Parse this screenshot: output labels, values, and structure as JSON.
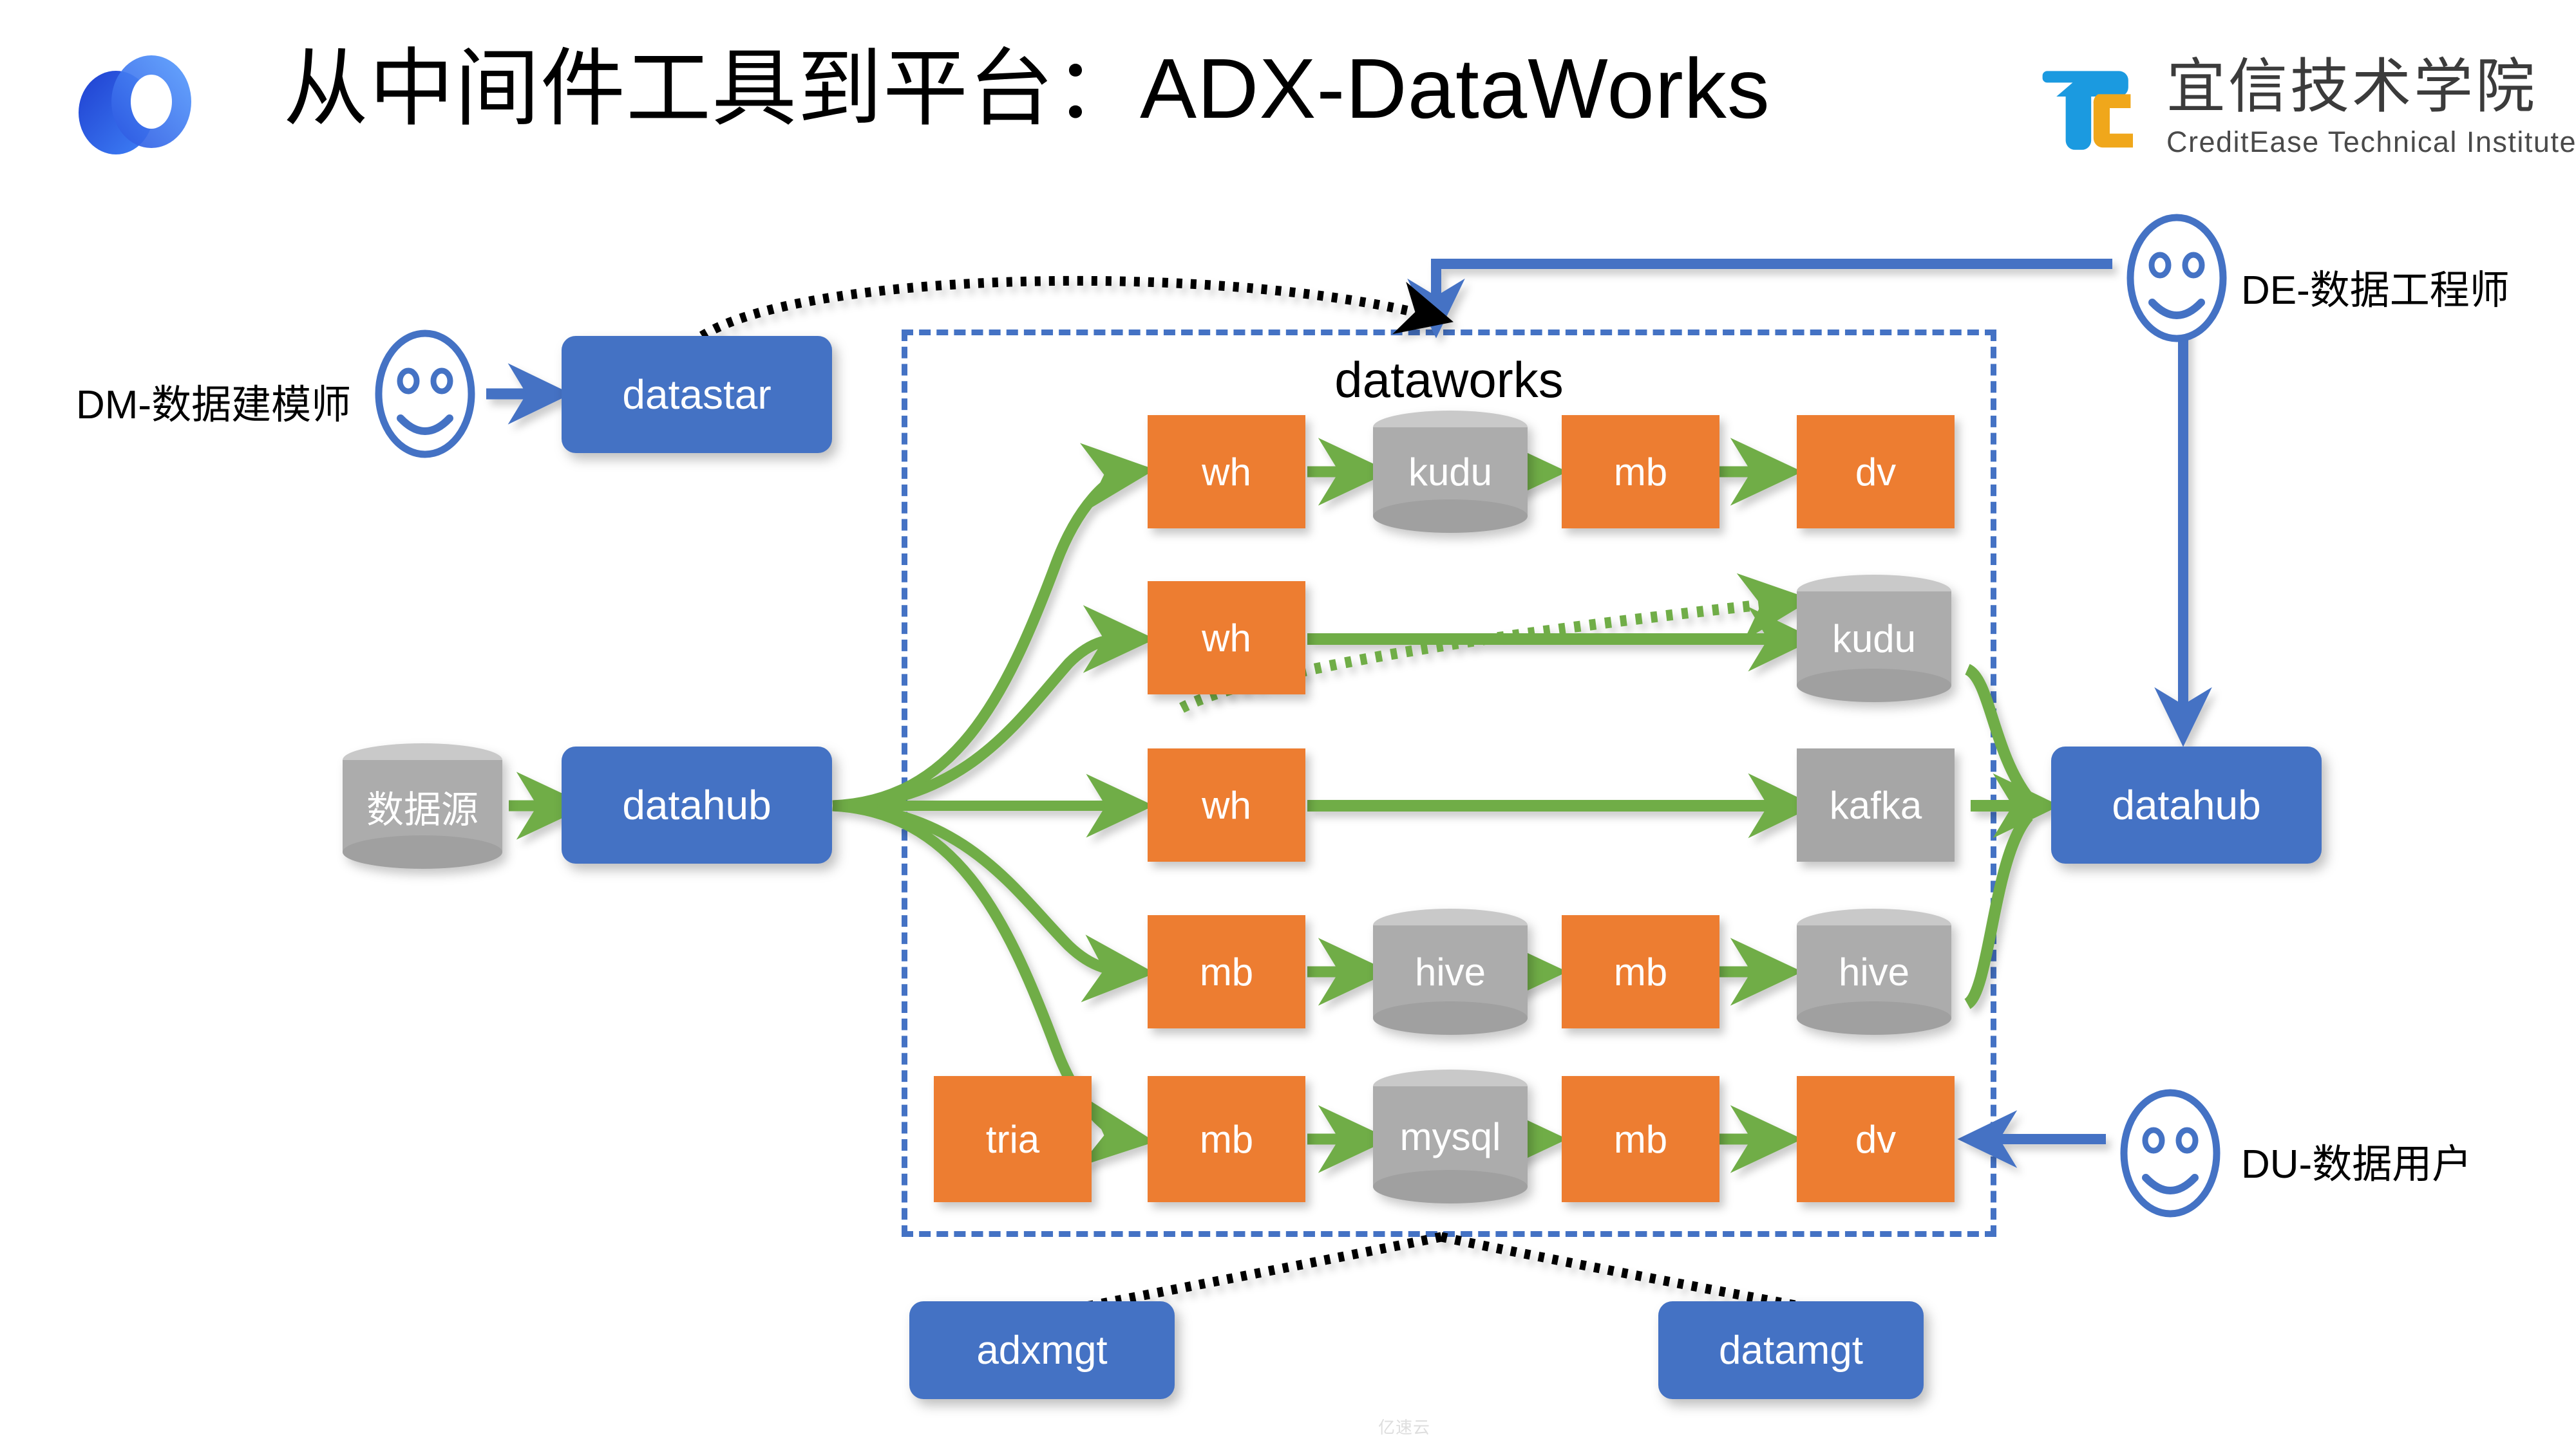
{
  "header": {
    "title": "从中间件工具到平台：ADX-DataWorks",
    "brand_icon": "two-overlapping-rings-logo-icon",
    "logo": {
      "glyph_icon": "tc-monogram-icon",
      "cn_name": "宜信技术学院",
      "en_name": "CreditEase Technical Institute"
    }
  },
  "colors": {
    "accent_blue": "#4472C4",
    "orange": "#ED7D31",
    "gray": "#A6A6A6",
    "green_arrow": "#70AD47",
    "black_dotted": "#000000"
  },
  "actors": [
    {
      "id": "dm",
      "label": "DM-数据建模师",
      "icon": "smiley-face-icon"
    },
    {
      "id": "de",
      "label": "DE-数据工程师",
      "icon": "smiley-face-icon"
    },
    {
      "id": "du",
      "label": "DU-数据用户",
      "icon": "smiley-face-icon"
    }
  ],
  "container": {
    "title": "dataworks",
    "border_style": "dashed"
  },
  "nodes": {
    "datastar": "datastar",
    "source": "数据源",
    "datahub_in": "datahub",
    "datahub_out": "datahub",
    "adxmgt": "adxmgt",
    "datamgt": "datamgt"
  },
  "pipelines": [
    {
      "row": 1,
      "steps": [
        {
          "label": "wh",
          "shape": "rect",
          "color": "orange"
        },
        {
          "label": "kudu",
          "shape": "cylinder",
          "color": "gray"
        },
        {
          "label": "mb",
          "shape": "rect",
          "color": "orange"
        },
        {
          "label": "dv",
          "shape": "rect",
          "color": "orange"
        }
      ]
    },
    {
      "row": 2,
      "steps": [
        {
          "label": "wh",
          "shape": "rect",
          "color": "orange"
        },
        {
          "label": "kudu",
          "shape": "cylinder",
          "color": "gray"
        }
      ]
    },
    {
      "row": 3,
      "steps": [
        {
          "label": "wh",
          "shape": "rect",
          "color": "orange"
        },
        {
          "label": "kafka",
          "shape": "rect",
          "color": "gray"
        }
      ]
    },
    {
      "row": 4,
      "steps": [
        {
          "label": "mb",
          "shape": "rect",
          "color": "orange"
        },
        {
          "label": "hive",
          "shape": "cylinder",
          "color": "gray"
        },
        {
          "label": "mb",
          "shape": "rect",
          "color": "orange"
        },
        {
          "label": "hive",
          "shape": "cylinder",
          "color": "gray"
        }
      ]
    },
    {
      "row": 5,
      "steps": [
        {
          "label": "tria",
          "shape": "rect",
          "color": "orange"
        },
        {
          "label": "mb",
          "shape": "rect",
          "color": "orange"
        },
        {
          "label": "mysql",
          "shape": "cylinder",
          "color": "gray"
        },
        {
          "label": "mb",
          "shape": "rect",
          "color": "orange"
        },
        {
          "label": "dv",
          "shape": "rect",
          "color": "orange"
        }
      ]
    }
  ],
  "watermark": "亿速云"
}
